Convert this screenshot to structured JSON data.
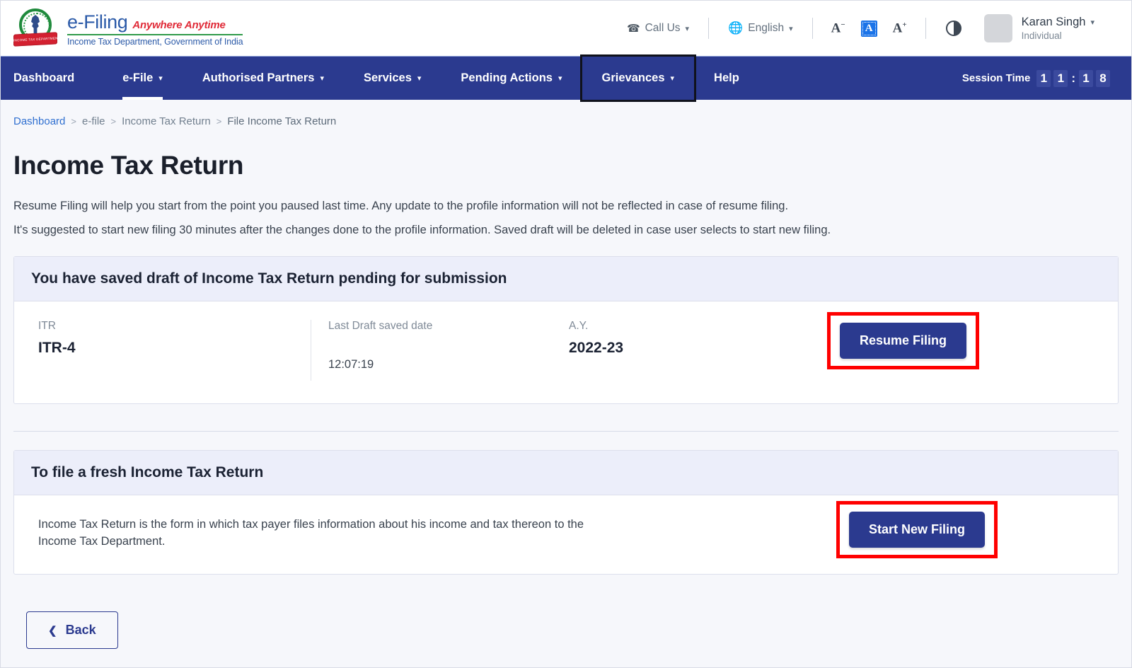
{
  "header": {
    "brand": {
      "emblem_text": "INCOME TAX DEPARTMENT",
      "title": "e-Filing",
      "tagline": "Anywhere Anytime",
      "subtitle": "Income Tax Department, Government of India"
    },
    "call_us": "Call Us",
    "language": "English",
    "font_decrease": "A",
    "font_normal": "A",
    "font_increase": "A",
    "user_name": "Karan Singh",
    "user_role": "Individual"
  },
  "nav": {
    "items": [
      {
        "label": "Dashboard",
        "has_caret": false
      },
      {
        "label": "e-File",
        "has_caret": true
      },
      {
        "label": "Authorised Partners",
        "has_caret": true
      },
      {
        "label": "Services",
        "has_caret": true
      },
      {
        "label": "Pending Actions",
        "has_caret": true
      },
      {
        "label": "Grievances",
        "has_caret": true
      },
      {
        "label": "Help",
        "has_caret": false
      }
    ],
    "session_label": "Session Time",
    "session_digits": [
      "1",
      "1",
      "1",
      "8"
    ],
    "session_colon": ":"
  },
  "breadcrumb": {
    "items": [
      "Dashboard",
      "e-file",
      "Income Tax Return",
      "File Income Tax Return"
    ],
    "separator": ">"
  },
  "main": {
    "title": "Income Tax Return",
    "desc_line1": "Resume Filing will help you start from the point you paused last time. Any update to the profile information will not be reflected in case of resume filing.",
    "desc_line2": "It's suggested to start new filing 30 minutes after the changes done to the profile information. Saved draft will be deleted in case user selects to start new filing.",
    "draft_card": {
      "heading": "You have saved draft of Income Tax Return pending for submission",
      "itr_label": "ITR",
      "itr_value": "ITR-4",
      "date_label": "Last Draft saved date",
      "date_value": "12:07:19",
      "ay_label": "A.Y.",
      "ay_value": "2022-23",
      "button": "Resume Filing"
    },
    "fresh_card": {
      "heading": "To file a fresh Income Tax Return",
      "text": "Income Tax Return is the form in which tax payer files information about his income and tax thereon to the Income Tax Department.",
      "button": "Start New Filing"
    },
    "back_button": "Back"
  }
}
